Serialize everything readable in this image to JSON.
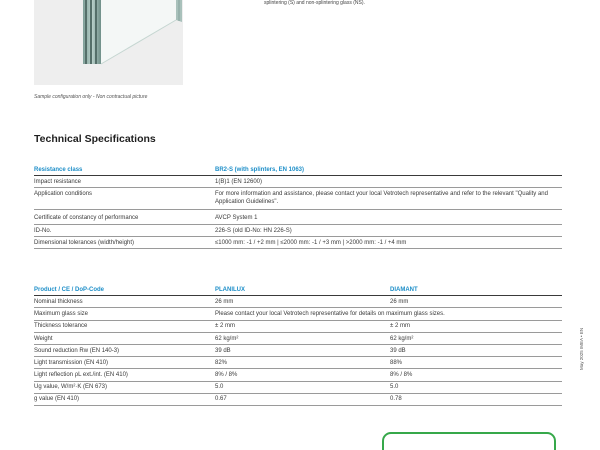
{
  "intro_text": "splintering (S) and non-splintering glass (NS).",
  "caption": "Sample configuration only - Non contractual picture",
  "section_title": "Technical Specifications",
  "table1": {
    "header": {
      "label": "Resistance class",
      "value": "BR2-S (with splinters, EN 1063)"
    },
    "rows": [
      {
        "label": "Impact resistance",
        "value": "1(B)1 (EN 12600)"
      },
      {
        "label": "Application conditions",
        "value": "For more information and assistance, please contact your local Vetrotech representative and refer to the relevant \"Quality and Application Guidelines\"."
      },
      {
        "label": "Certificate of constancy of performance",
        "value": "AVCP System 1"
      },
      {
        "label": "ID-No.",
        "value": "226-S (old ID-No: HN 226-S)"
      },
      {
        "label": "Dimensional tolerances (width/height)",
        "value": "≤1000 mm: -1 / +2 mm | ≤2000 mm: -1 / +3 mm | >2000 mm: -1 / +4 mm"
      }
    ]
  },
  "table2": {
    "header": {
      "label": "Product / CE / DoP-Code",
      "col1": "PLANILUX",
      "col2": "DIAMANT"
    },
    "rows": [
      {
        "label": "Nominal thickness",
        "col1": "26 mm",
        "col2": "26 mm"
      },
      {
        "label": "Maximum glass size",
        "merged": "Please contact your local Vetrotech representative for details on maximum glass sizes."
      },
      {
        "label": "Thickness tolerance",
        "col1": "± 2 mm",
        "col2": "± 2 mm"
      },
      {
        "label": "Weight",
        "col1": "62 kg/m²",
        "col2": "62 kg/m²"
      },
      {
        "label": "Sound reduction Rw (EN 140-3)",
        "col1": "39 dB",
        "col2": "39 dB"
      },
      {
        "label": "Light transmission (EN 410)",
        "col1": "82%",
        "col2": "88%"
      },
      {
        "label": "Light reflection ρL ext./int. (EN 410)",
        "col1": "8% / 8%",
        "col2": "8% / 8%"
      },
      {
        "label": "Ug value, W/m²·K (EN 673)",
        "col1": "5.0",
        "col2": "5.0"
      },
      {
        "label": "g value (EN 410)",
        "col1": "0.67",
        "col2": "0.78"
      }
    ]
  },
  "side_text": "May 2025 IMEA • EN"
}
